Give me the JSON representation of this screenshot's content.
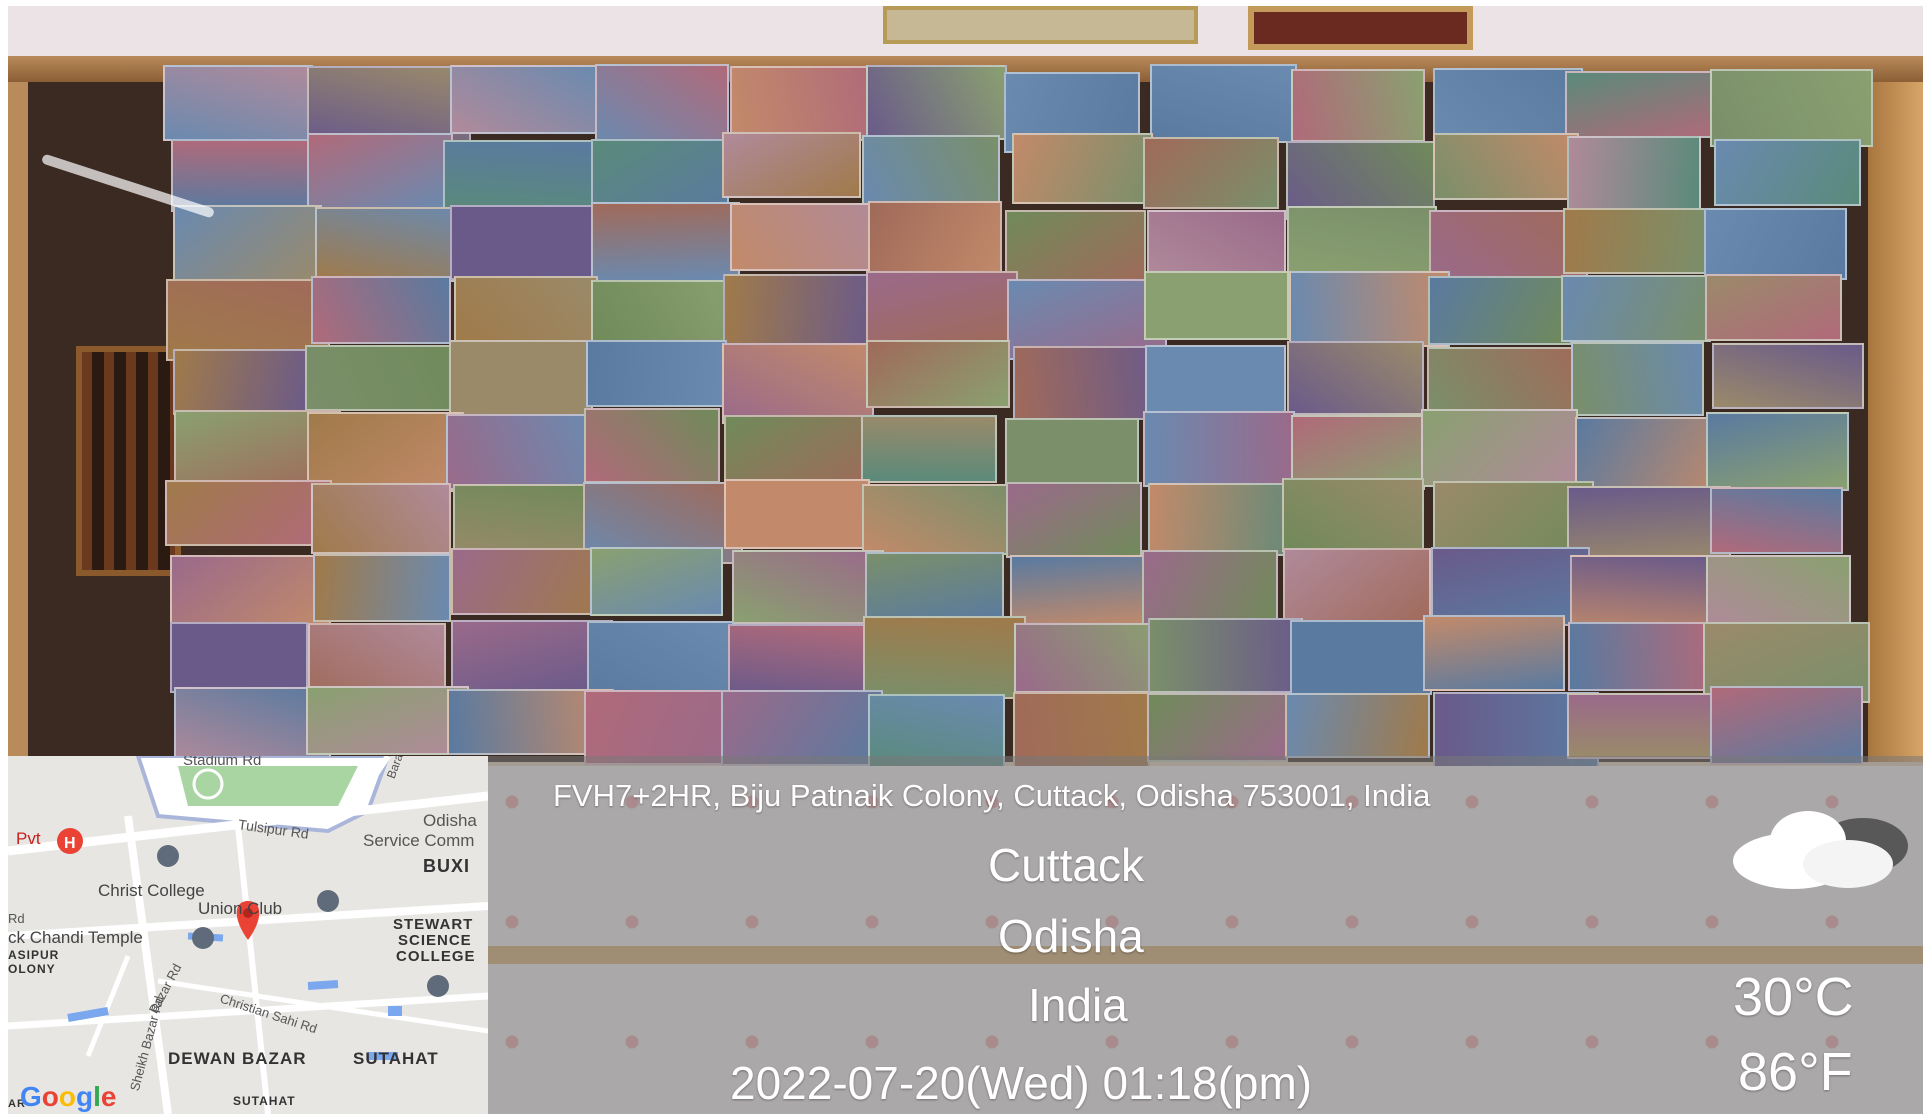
{
  "overlay": {
    "address": "FVH7+2HR, Biju Patnaik Colony, Cuttack, Odisha 753001, India",
    "city": "Cuttack",
    "state": "Odisha",
    "country": "India",
    "datetime": "2022-07-20(Wed)   01:18(pm)",
    "temp_c": "30°C",
    "temp_f": "86°F",
    "weather_icon": "partly-cloudy-icon"
  },
  "map": {
    "labels": {
      "stadium_rd": "Stadium Rd",
      "tulsipur_rd": "Tulsipur Rd",
      "odisha": "Odisha",
      "service_comm": "Service Comm",
      "pvt": "Pvt",
      "buxi": "BUXI",
      "christ_college": "Christ College",
      "union_club": "Union Club",
      "rd": "Rd",
      "chandi_temple": "ck Chandi Temple",
      "stewart": "STEWART",
      "science": "SCIENCE",
      "college": "COLLEGE",
      "asipur": "ASIPUR",
      "olony": "OLONY",
      "christian_sahi_rd": "Christian Sahi Rd",
      "bazar_rd": "Bazar Rd",
      "sheikh_bazar_rd": "Sheikh Bazar Rd",
      "dewan_bazar": "DEWAN BAZAR",
      "sutahat": "SUTAHAT",
      "sutahat_small": "SUTAHAT",
      "ar": "AR",
      "barab": "Barab"
    },
    "logo": "Google"
  },
  "colors": {
    "overlay_bg": "#787878",
    "map_bg": "#e8e6e3",
    "pin_red": "#ea4335",
    "wood": "#b98b5a"
  }
}
